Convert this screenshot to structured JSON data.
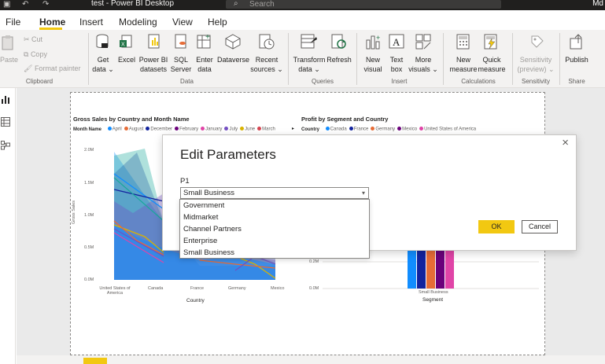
{
  "window": {
    "title": "test - Power BI Desktop",
    "search_placeholder": "Search",
    "user_initials": "Md"
  },
  "menu": {
    "items": [
      "File",
      "Home",
      "Insert",
      "Modeling",
      "View",
      "Help"
    ],
    "active": "Home"
  },
  "ribbon": {
    "clipboard": {
      "paste": "Paste",
      "cut": "Cut",
      "copy": "Copy",
      "format_painter": "Format painter",
      "group": "Clipboard"
    },
    "data": {
      "get_data": "Get\ndata ⌄",
      "excel": "Excel",
      "pbi_datasets": "Power BI\ndatasets",
      "sql_server": "SQL\nServer",
      "enter_data": "Enter\ndata",
      "dataverse": "Dataverse",
      "recent_sources": "Recent\nsources ⌄",
      "group": "Data"
    },
    "queries": {
      "transform": "Transform\ndata ⌄",
      "refresh": "Refresh",
      "group": "Queries"
    },
    "insert": {
      "new_visual": "New\nvisual",
      "text_box": "Text\nbox",
      "more_visuals": "More\nvisuals ⌄",
      "group": "Insert"
    },
    "calculations": {
      "new_measure": "New\nmeasure",
      "quick_measure": "Quick\nmeasure",
      "group": "Calculations"
    },
    "sensitivity": {
      "label": "Sensitivity\n(preview) ⌄",
      "group": "Sensitivity"
    },
    "share": {
      "publish": "Publish",
      "group": "Share"
    }
  },
  "visual_left": {
    "title": "Gross Sales by Country and Month Name",
    "legend_title": "Month Name",
    "legend": [
      {
        "name": "April",
        "color": "#118dff"
      },
      {
        "name": "August",
        "color": "#e66c37"
      },
      {
        "name": "December",
        "color": "#12239e"
      },
      {
        "name": "February",
        "color": "#6b007b"
      },
      {
        "name": "January",
        "color": "#e044a7"
      },
      {
        "name": "July",
        "color": "#744ec2"
      },
      {
        "name": "June",
        "color": "#d9b300"
      },
      {
        "name": "March",
        "color": "#d64550"
      }
    ],
    "ylabel": "Gross Sales",
    "xlabel": "Country",
    "yticks": [
      "2.0M",
      "1.5M",
      "1.0M",
      "0.5M",
      "0.0M"
    ],
    "xticks": [
      "United States of America",
      "Canada",
      "France",
      "Germany",
      "Mexico"
    ]
  },
  "visual_right": {
    "title": "Profit by Segment and Country",
    "legend_title": "Country",
    "legend": [
      {
        "name": "Canada",
        "color": "#118dff"
      },
      {
        "name": "France",
        "color": "#12239e"
      },
      {
        "name": "Germany",
        "color": "#e66c37"
      },
      {
        "name": "Mexico",
        "color": "#6b007b"
      },
      {
        "name": "United States of America",
        "color": "#e044a7"
      }
    ],
    "yticks": [
      "0.2M",
      "0.0M"
    ],
    "xtick": "Small Business",
    "xlabel": "Segment"
  },
  "dialog": {
    "title": "Edit Parameters",
    "param_label": "P1",
    "selected": "Small Business",
    "options": [
      "Government",
      "Midmarket",
      "Channel Partners",
      "Enterprise",
      "Small Business"
    ],
    "ok": "OK",
    "cancel": "Cancel"
  }
}
